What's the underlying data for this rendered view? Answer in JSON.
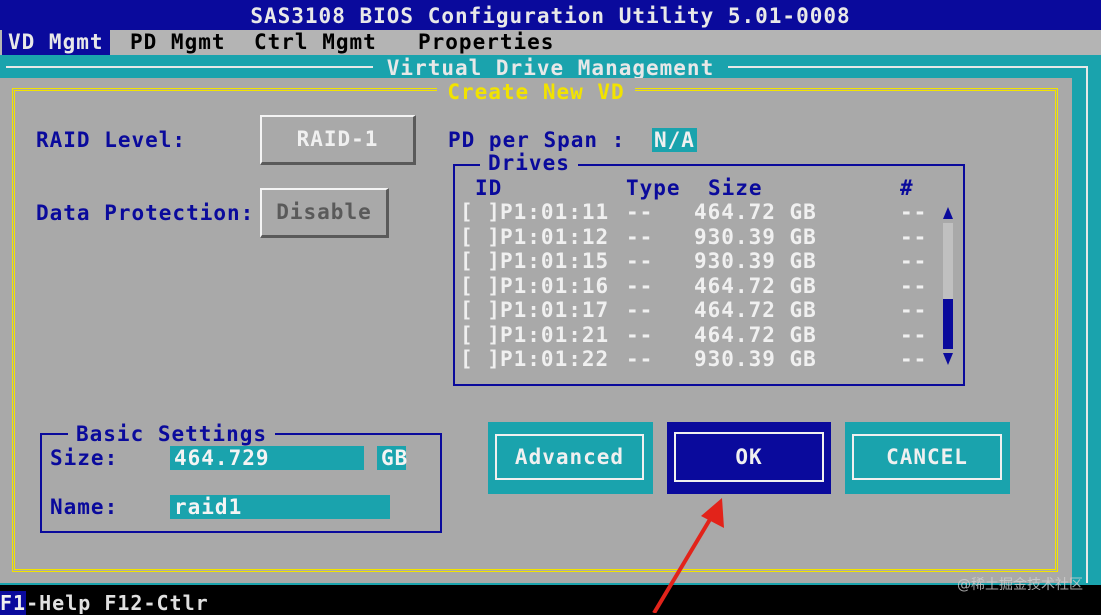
{
  "window": {
    "title": "SAS3108 BIOS Configuration Utility 5.01-0008"
  },
  "menu": [
    {
      "label": "VD Mgmt",
      "active": true
    },
    {
      "label": "PD Mgmt",
      "active": false
    },
    {
      "label": "Ctrl Mgmt",
      "active": false
    },
    {
      "label": "Properties",
      "active": false
    }
  ],
  "panel": {
    "title": "Virtual Drive Management"
  },
  "dialog": {
    "title": "Create New VD",
    "raid_label": "RAID Level:",
    "raid_value": "RAID-1",
    "data_protection_label": "Data Protection:",
    "data_protection_value": "Disable",
    "pd_per_span_label": "PD per Span :",
    "pd_per_span_value": "N/A",
    "drives": {
      "title": "Drives",
      "headers": {
        "id": "ID",
        "type": "Type",
        "size": "Size",
        "count": "#"
      },
      "rows": [
        {
          "check": "[ ]",
          "id": "P1:01:11",
          "type": "--",
          "size": "464.72 GB",
          "count": "--"
        },
        {
          "check": "[ ]",
          "id": "P1:01:12",
          "type": "--",
          "size": "930.39 GB",
          "count": "--"
        },
        {
          "check": "[ ]",
          "id": "P1:01:15",
          "type": "--",
          "size": "930.39 GB",
          "count": "--"
        },
        {
          "check": "[ ]",
          "id": "P1:01:16",
          "type": "--",
          "size": "464.72 GB",
          "count": "--"
        },
        {
          "check": "[ ]",
          "id": "P1:01:17",
          "type": "--",
          "size": "464.72 GB",
          "count": "--"
        },
        {
          "check": "[ ]",
          "id": "P1:01:21",
          "type": "--",
          "size": "464.72 GB",
          "count": "--"
        },
        {
          "check": "[ ]",
          "id": "P1:01:22",
          "type": "--",
          "size": "930.39 GB",
          "count": "--"
        }
      ]
    },
    "basic": {
      "title": "Basic Settings",
      "size_label": "Size:",
      "size_value": "464.729",
      "size_unit": "GB",
      "name_label": "Name:",
      "name_value": "raid1"
    },
    "buttons": {
      "advanced": "Advanced",
      "ok": "OK",
      "cancel": "CANCEL"
    }
  },
  "status": {
    "f1_key": "F1",
    "f1_text": "-Help F12-Ctlr"
  },
  "watermark": "@稀土掘金技术社区",
  "colors": {
    "bios_blue": "#0a0a9c",
    "teal": "#1aa3ad",
    "gray": "#a9a9a9",
    "yellow": "#f2e300",
    "annotation_arrow": "#e2231a"
  }
}
